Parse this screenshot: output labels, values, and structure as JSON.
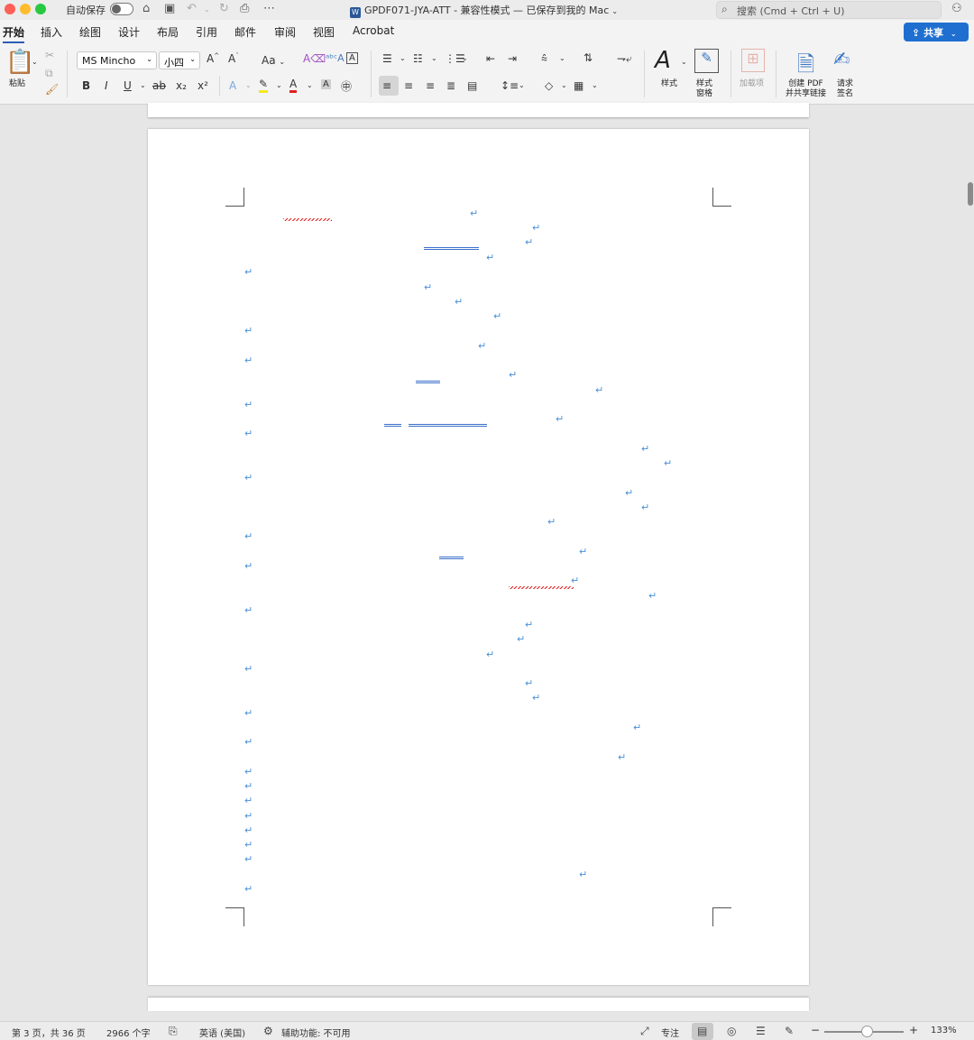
{
  "titlebar": {
    "autosave_label": "自动保存",
    "doc_title": "GPDF071-JYA-ATT  -  兼容性模式 — 已保存到我的 Mac",
    "search_placeholder": "搜索 (Cmd + Ctrl + U)"
  },
  "tabs": [
    "开始",
    "插入",
    "绘图",
    "设计",
    "布局",
    "引用",
    "邮件",
    "审阅",
    "视图",
    "Acrobat"
  ],
  "share_label": "共享",
  "ribbon": {
    "paste_label": "粘贴",
    "font_name": "MS Mincho",
    "font_size": "小四",
    "case_label": "Aa",
    "bold": "B",
    "italic": "I",
    "underline": "U",
    "strike": "ab",
    "subscript": "x₂",
    "superscript": "x²",
    "styles_label": "样式",
    "styles_pane_label": "样式\n窗格",
    "addins_label": "加载项",
    "create_pdf_label": "创建 PDF\n并共享链接",
    "request_sign_label": "请求\n签名"
  },
  "paragraph_mark": "↵",
  "statusbar": {
    "page_info": "第 3 页，共 36 页",
    "word_count": "2966 个字",
    "language": "英语 (美国)",
    "accessibility": "辅助功能: 不可用",
    "focus_label": "专注",
    "zoom": "133%"
  }
}
